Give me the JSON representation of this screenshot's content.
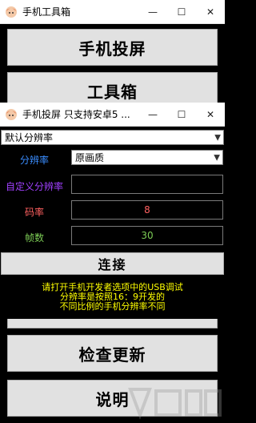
{
  "main_window": {
    "title": "手机工具箱",
    "buttons": {
      "mirror": "手机投屏",
      "toolbox": "工具箱",
      "update": "检查更新",
      "help": "说明"
    },
    "caption": {
      "minimize": "—",
      "maximize": "☐",
      "close": "✕"
    }
  },
  "dialog": {
    "title": "手机投屏 只支持安卓5 ...",
    "caption": {
      "minimize": "—",
      "maximize": "☐",
      "close": "✕"
    },
    "resolution_mode": {
      "value": "默认分辨率"
    },
    "resolution": {
      "label": "分辨率",
      "value": "原画质"
    },
    "custom_resolution": {
      "label": "自定义分辨率",
      "value": ""
    },
    "bitrate": {
      "label": "码率",
      "value": "8"
    },
    "framerate": {
      "label": "帧数",
      "value": "30"
    },
    "connect_label": "连接",
    "info_lines": [
      "请打开手机开发者选项中的USB调试",
      "分辨率是按照16：9开发的",
      "不同比例的手机分辨率不同"
    ]
  },
  "colors": {
    "resolution_label": "#3a8dff",
    "custom_resolution_label": "#a040ff",
    "bitrate_label": "#ff6060",
    "framerate_label": "#7ccc55",
    "info_text": "#ffff00"
  }
}
